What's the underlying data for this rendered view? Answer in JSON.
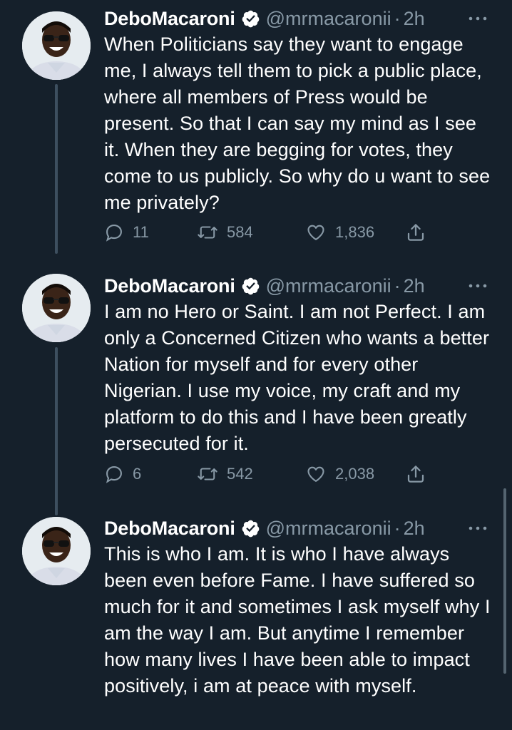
{
  "tweets": [
    {
      "name": "DeboMacaroni",
      "handle": "@mrmacaronii",
      "separator": "·",
      "time": "2h",
      "text": "When Politicians say they want to engage me, I always tell them to pick a public place, where all members of Press would be present. So that I can say my mind as I see it. When they are begging for votes, they come to us publicly. So why do u want to see me privately?",
      "replies": "11",
      "retweets": "584",
      "likes": "1,836"
    },
    {
      "name": "DeboMacaroni",
      "handle": "@mrmacaronii",
      "separator": "·",
      "time": "2h",
      "text": "I am no Hero or Saint. I am not Perfect. I am only a Concerned Citizen who wants a better Nation for myself and for every other Nigerian. I use my voice, my craft and my platform to do this and I have been greatly persecuted for it.",
      "replies": "6",
      "retweets": "542",
      "likes": "2,038"
    },
    {
      "name": "DeboMacaroni",
      "handle": "@mrmacaronii",
      "separator": "·",
      "time": "2h",
      "text": "This is who I am. It is who I have always been even before Fame. I have suffered so much for it and sometimes I ask myself why I am the way I am. But anytime I remember how many lives I have been able to impact positively, i am at peace with myself."
    }
  ],
  "icons": {
    "verified": "verified-badge-icon",
    "more": "more-dots-icon",
    "reply": "reply-bubble-icon",
    "retweet": "retweet-icon",
    "like": "heart-icon",
    "share": "share-icon"
  },
  "colors": {
    "background": "#15202b",
    "secondary_text": "#8899a6",
    "thread_line": "#3d4f5f"
  }
}
